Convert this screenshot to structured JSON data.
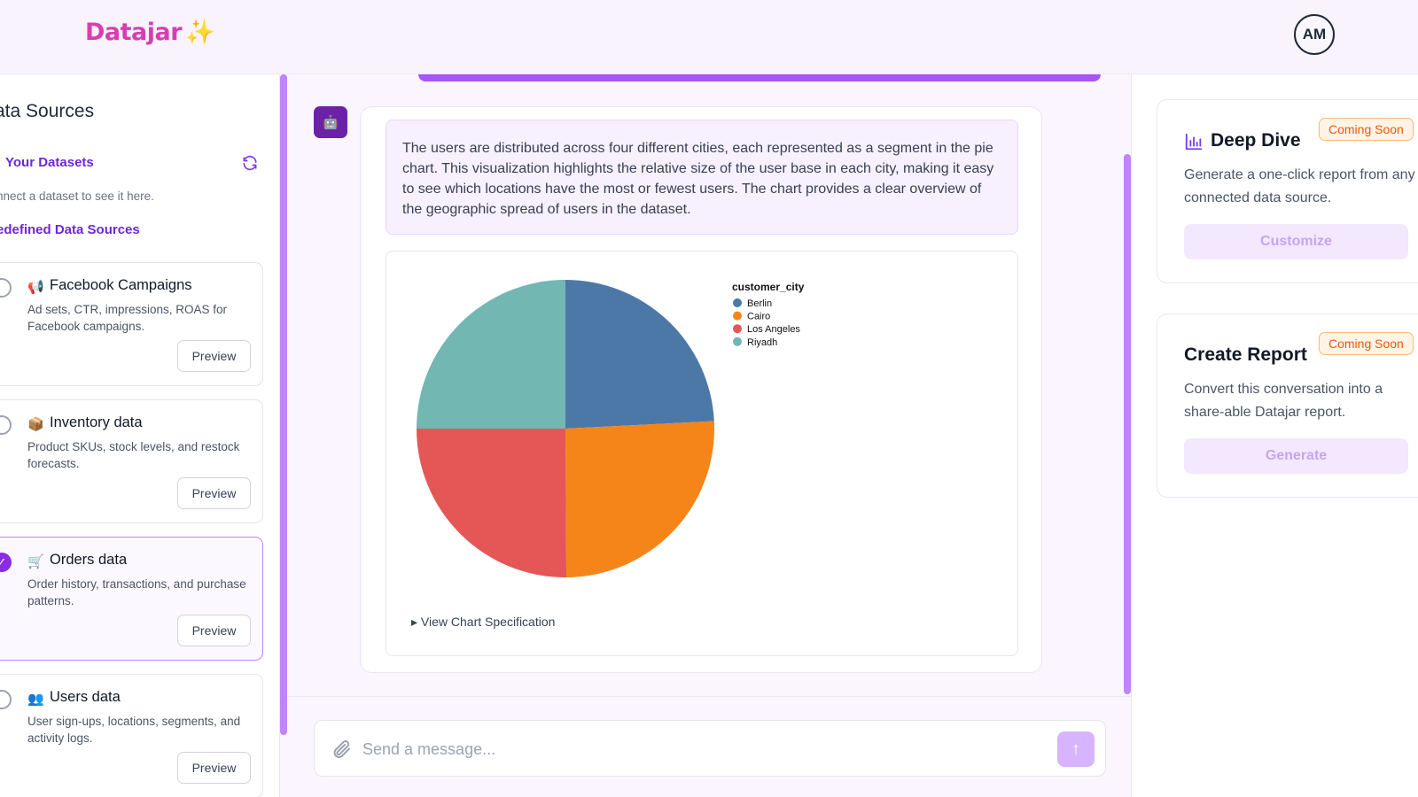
{
  "app": {
    "logo": "Datajar",
    "logo_sparkle": "✨",
    "avatar_initials": "AM"
  },
  "sidebar": {
    "title": "ata Sources",
    "your_datasets": "Your Datasets",
    "your_datasets_note": "nnect a dataset to see it here.",
    "predefined_title": "edefined Data Sources",
    "preview_label": "Preview",
    "items": [
      {
        "icon": "📢",
        "name": "Facebook Campaigns",
        "desc": "Ad sets, CTR, impressions, ROAS for Facebook campaigns.",
        "selected": false
      },
      {
        "icon": "📦",
        "name": "Inventory data",
        "desc": "Product SKUs, stock levels, and restock forecasts.",
        "selected": false
      },
      {
        "icon": "🛒",
        "name": "Orders data",
        "desc": "Order history, transactions, and purchase patterns.",
        "selected": true
      },
      {
        "icon": "👥",
        "name": "Users data",
        "desc": "User sign-ups, locations, segments, and activity logs.",
        "selected": false
      }
    ]
  },
  "chat": {
    "bot_icon": "🤖",
    "message": "The users are distributed across four different cities, each represented as a segment in the pie chart. This visualization highlights the relative size of the user base in each city, making it easy to see which locations have the most or fewest users. The chart provides a clear overview of the geographic spread of users in the dataset.",
    "view_spec": "View Chart Specification",
    "composer_placeholder": "Send a message..."
  },
  "chart_data": {
    "type": "pie",
    "legend_title": "customer_city",
    "legend_position": "top-right",
    "categories": [
      "Berlin",
      "Cairo",
      "Los Angeles",
      "Riyadh"
    ],
    "values": [
      24.2,
      25.7,
      25.1,
      25.0
    ],
    "colors": [
      "#4c78a8",
      "#f58518",
      "#e45756",
      "#72b7b2"
    ]
  },
  "right_panel": {
    "deep_dive": {
      "title": "Deep Dive",
      "badge": "Coming Soon",
      "desc": "Generate a one-click report from any connected data source.",
      "button": "Customize"
    },
    "create_report": {
      "title": "Create Report",
      "badge": "Coming Soon",
      "desc": "Convert this conversation into a share-able Datajar report.",
      "button": "Generate"
    }
  }
}
